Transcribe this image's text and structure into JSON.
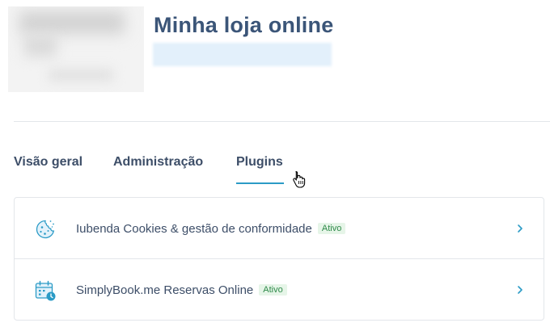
{
  "store": {
    "title": "Minha loja online"
  },
  "tabs": [
    {
      "label": "Visão geral",
      "active": false
    },
    {
      "label": "Administração",
      "active": false
    },
    {
      "label": "Plugins",
      "active": true
    }
  ],
  "plugins": [
    {
      "name": "Iubenda Cookies & gestão de conformidade",
      "status": "Ativo",
      "icon": "cookie-icon"
    },
    {
      "name": "SimplyBook.me Reservas Online",
      "status": "Ativo",
      "icon": "calendar-clock-icon"
    }
  ],
  "colors": {
    "accent": "#2b9bc6",
    "title": "#3b5578",
    "badge_text": "#2f8a4a",
    "badge_bg": "#e6f5e8"
  }
}
